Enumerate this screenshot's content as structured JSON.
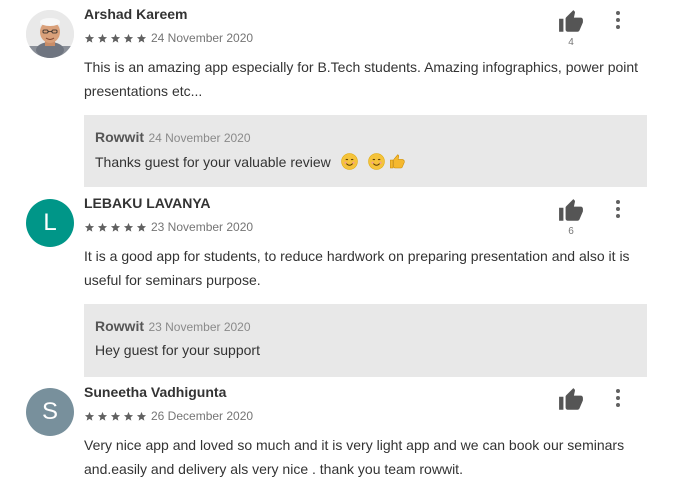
{
  "colors": {
    "avatar_l": "#009688",
    "avatar_s": "#78909c",
    "reply_bg": "#e8e8e8",
    "star": "#616161"
  },
  "reviews": [
    {
      "author": "Arshad Kareem",
      "rating": 5,
      "date": "24 November 2020",
      "text": "This is an amazing app especially for B.Tech students. Amazing infographics, power point presentations etc...",
      "likes": "4",
      "avatar": {
        "type": "photo"
      },
      "reply": {
        "name": "Rowwit",
        "date": "24 November 2020",
        "text": "Thanks guest for your valuable review",
        "emojis": [
          "smiling-face-icon",
          "smiling-face-icon",
          "thumbs-up-icon"
        ]
      }
    },
    {
      "author": "LEBAKU LAVANYA",
      "rating": 5,
      "date": "23 November 2020",
      "text": "It is a good app for students, to reduce hardwork on preparing presentation and also it is useful for seminars purpose.",
      "likes": "6",
      "avatar": {
        "type": "letter",
        "letter": "L"
      },
      "reply": {
        "name": "Rowwit",
        "date": "23 November 2020",
        "text": "Hey guest for your support"
      }
    },
    {
      "author": "Suneetha Vadhigunta",
      "rating": 5,
      "date": "26 December 2020",
      "text": "Very nice app and loved so much and it is very light app and we can book our seminars and.easily and delivery als very nice . thank you team rowwit.",
      "likes": "",
      "avatar": {
        "type": "letter",
        "letter": "S"
      }
    }
  ]
}
